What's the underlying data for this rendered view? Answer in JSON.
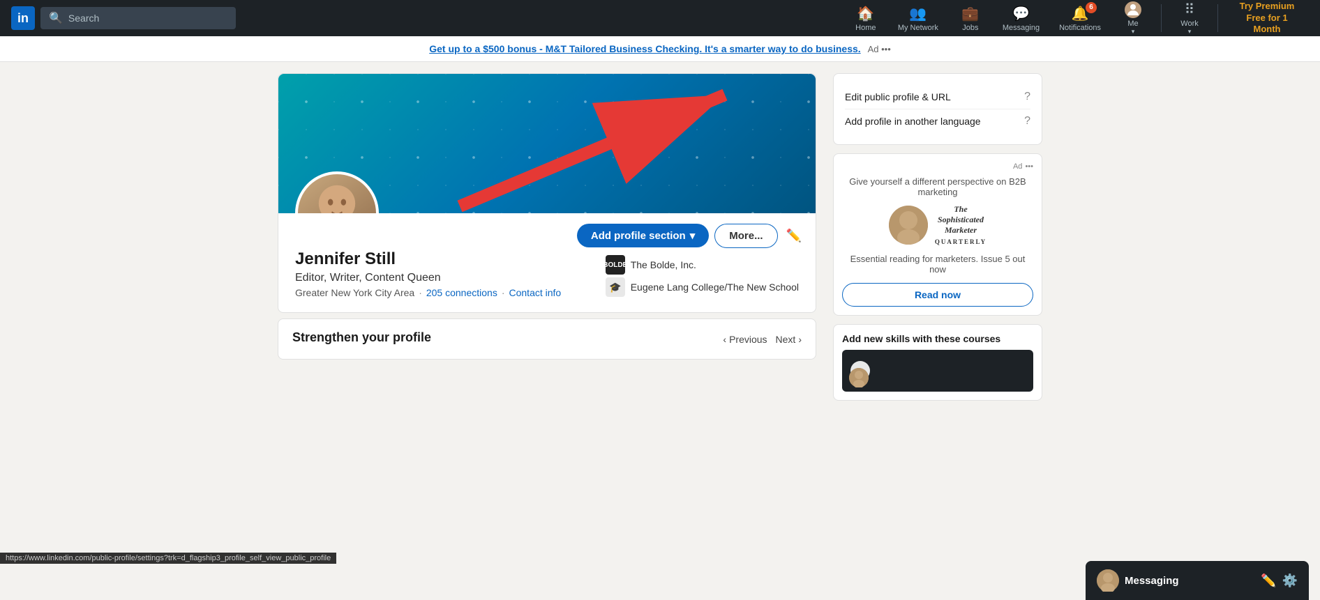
{
  "navbar": {
    "logo": "in",
    "search_placeholder": "Search",
    "nav_items": [
      {
        "id": "home",
        "icon": "🏠",
        "label": "Home"
      },
      {
        "id": "mynetwork",
        "icon": "👥",
        "label": "My Network"
      },
      {
        "id": "jobs",
        "icon": "💼",
        "label": "Jobs"
      },
      {
        "id": "messaging",
        "icon": "💬",
        "label": "Messaging"
      },
      {
        "id": "notifications",
        "icon": "🔔",
        "label": "Notifications",
        "badge": "6"
      }
    ],
    "me_label": "Me",
    "work_label": "Work",
    "premium_label": "Try Premium Free for 1 Month"
  },
  "ad_banner": {
    "link_text": "Get up to a $500 bonus - M&T Tailored Business Checking. It's a smarter way to do business.",
    "ad_label": "Ad"
  },
  "profile": {
    "name": "Jennifer Still",
    "title": "Editor, Writer, Content Queen",
    "location": "Greater New York City Area",
    "connections": "205 connections",
    "contact_info": "Contact info",
    "company_name": "The Bolde, Inc.",
    "school_name": "Eugene Lang College/The New School",
    "add_section_label": "Add profile section",
    "more_label": "More..."
  },
  "sidebar": {
    "edit_profile_label": "Edit public profile & URL",
    "add_language_label": "Add profile in another language",
    "ad": {
      "label": "Ad",
      "description": "Give yourself a different perspective on B2B marketing",
      "caption": "Essential reading for marketers. Issue 5 out now",
      "read_now_label": "Read now"
    },
    "skills_label": "Add new skills with these courses"
  },
  "strengthen": {
    "title": "Strengthen your profile",
    "previous_label": "Previous",
    "next_label": "Next"
  },
  "messaging": {
    "label": "Messaging"
  },
  "url_bar": {
    "text": "https://www.linkedin.com/public-profile/settings?trk=d_flagship3_profile_self_view_public_profile"
  }
}
